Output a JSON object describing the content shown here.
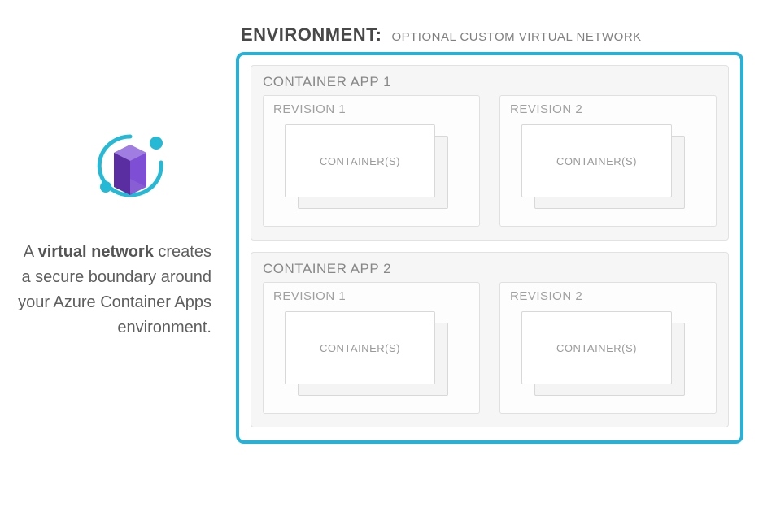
{
  "caption": {
    "pre": "A ",
    "bold": "virtual network",
    "post": " creates a secure boundary around your Azure Container Apps environment."
  },
  "environment": {
    "label": "ENVIRONMENT:",
    "subtitle": "OPTIONAL CUSTOM VIRTUAL NETWORK",
    "apps": [
      {
        "title": "CONTAINER APP 1",
        "revisions": [
          {
            "title": "REVISION 1",
            "container_label": "CONTAINER(S)"
          },
          {
            "title": "REVISION 2",
            "container_label": "CONTAINER(S)"
          }
        ]
      },
      {
        "title": "CONTAINER APP 2",
        "revisions": [
          {
            "title": "REVISION 1",
            "container_label": "CONTAINER(S)"
          },
          {
            "title": "REVISION 2",
            "container_label": "CONTAINER(S)"
          }
        ]
      }
    ]
  },
  "icon_name": "virtual-network-icon"
}
